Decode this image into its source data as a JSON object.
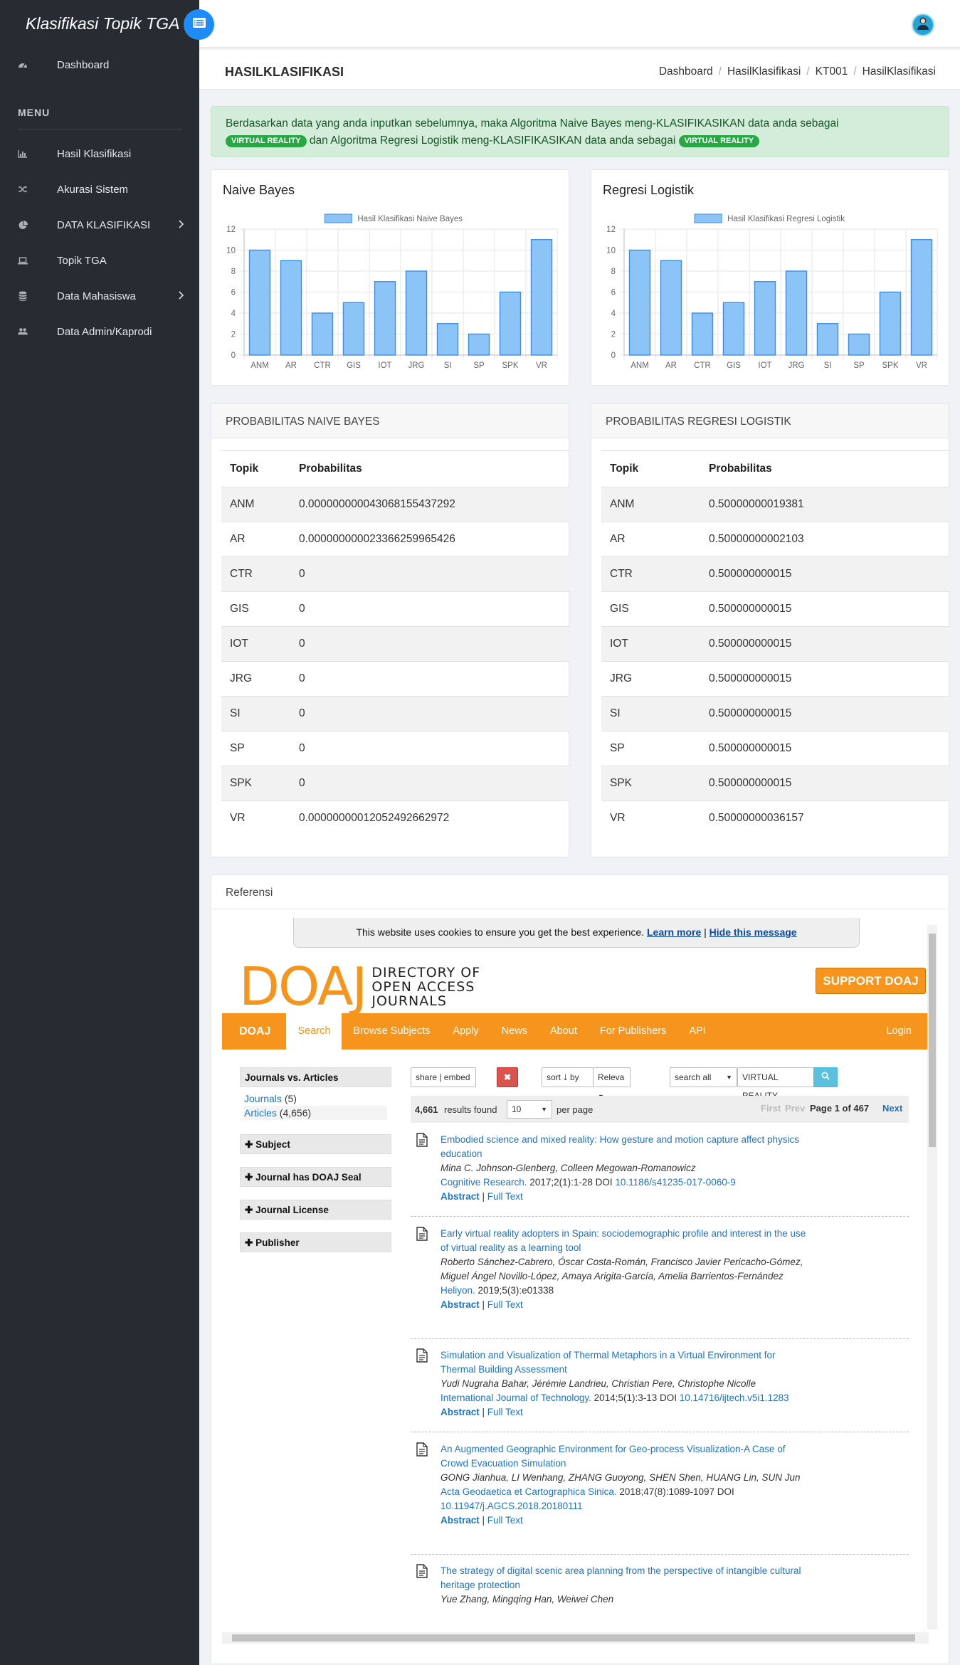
{
  "sidebar": {
    "brand": "Klasifikasi Topik TGA",
    "menu_heading": "MENU",
    "items": [
      {
        "label": "Dashboard",
        "icon": "dashboard-icon"
      },
      {
        "label": "Hasil Klasifikasi",
        "icon": "bar-chart-icon"
      },
      {
        "label": "Akurasi Sistem",
        "icon": "shuffle-icon"
      },
      {
        "label": "DATA KLASIFIKASI",
        "icon": "pie-chart-icon"
      },
      {
        "label": "Topik TGA",
        "icon": "laptop-icon"
      },
      {
        "label": "Data Mahasiswa",
        "icon": "database-icon"
      },
      {
        "label": "Data Admin/Kaprodi",
        "icon": "users-icon"
      }
    ]
  },
  "header": {
    "title": "HASILKLASIFIKASI",
    "breadcrumb": [
      "Dashboard",
      "HasilKlasifikasi",
      "KT001",
      "HasilKlasifikasi"
    ]
  },
  "alert": {
    "text1": "Berdasarkan data yang anda inputkan sebelumnya, maka Algoritma Naive Bayes meng-KLASIFIKASIKAN data anda sebagai",
    "badge1": "VIRTUAL REALITY",
    "text2": "dan Algoritma Regresi Logistik meng-KLASIFIKASIKAN data anda sebagai",
    "badge2": "VIRTUAL REALITY"
  },
  "charts": {
    "nb_title": "Naive Bayes",
    "lr_title": "Regresi Logistik"
  },
  "chart_data": [
    {
      "type": "bar",
      "title": "Naive Bayes",
      "categories": [
        "ANM",
        "AR",
        "CTR",
        "GIS",
        "IOT",
        "JRG",
        "SI",
        "SP",
        "SPK",
        "VR"
      ],
      "series": [
        {
          "name": "Hasil Klasifikasi Naive Bayes",
          "values": [
            10,
            9,
            4,
            5,
            7,
            8,
            3,
            2,
            6,
            11
          ]
        }
      ],
      "yticks": [
        0,
        2,
        4,
        6,
        8,
        10,
        12
      ],
      "ylim": [
        0,
        12
      ],
      "color": "#8cc4f7",
      "border_color": "#3b8de6",
      "legend_position": "top",
      "grid": true
    },
    {
      "type": "bar",
      "title": "Regresi Logistik",
      "categories": [
        "ANM",
        "AR",
        "CTR",
        "GIS",
        "IOT",
        "JRG",
        "SI",
        "SP",
        "SPK",
        "VR"
      ],
      "series": [
        {
          "name": "Hasil Klasifikasi Regresi Logistik",
          "values": [
            10,
            9,
            4,
            5,
            7,
            8,
            3,
            2,
            6,
            11
          ]
        }
      ],
      "yticks": [
        0,
        2,
        4,
        6,
        8,
        10,
        12
      ],
      "ylim": [
        0,
        12
      ],
      "color": "#8cc4f7",
      "border_color": "#3b8de6",
      "legend_position": "top",
      "grid": true
    }
  ],
  "prob_nb": {
    "heading": "PROBABILITAS NAIVE BAYES",
    "col_topik": "Topik",
    "col_prob": "Probabilitas",
    "rows": [
      {
        "topik": "ANM",
        "prob": "0.000000000043068155437292"
      },
      {
        "topik": "AR",
        "prob": "0.000000000023366259965426"
      },
      {
        "topik": "CTR",
        "prob": "0"
      },
      {
        "topik": "GIS",
        "prob": "0"
      },
      {
        "topik": "IOT",
        "prob": "0"
      },
      {
        "topik": "JRG",
        "prob": "0"
      },
      {
        "topik": "SI",
        "prob": "0"
      },
      {
        "topik": "SP",
        "prob": "0"
      },
      {
        "topik": "SPK",
        "prob": "0"
      },
      {
        "topik": "VR",
        "prob": "0.00000000012052492662972"
      }
    ]
  },
  "prob_lr": {
    "heading": "PROBABILITAS REGRESI LOGISTIK",
    "col_topik": "Topik",
    "col_prob": "Probabilitas",
    "rows": [
      {
        "topik": "ANM",
        "prob": "0.50000000019381"
      },
      {
        "topik": "AR",
        "prob": "0.50000000002103"
      },
      {
        "topik": "CTR",
        "prob": "0.500000000015"
      },
      {
        "topik": "GIS",
        "prob": "0.500000000015"
      },
      {
        "topik": "IOT",
        "prob": "0.500000000015"
      },
      {
        "topik": "JRG",
        "prob": "0.500000000015"
      },
      {
        "topik": "SI",
        "prob": "0.500000000015"
      },
      {
        "topik": "SP",
        "prob": "0.500000000015"
      },
      {
        "topik": "SPK",
        "prob": "0.500000000015"
      },
      {
        "topik": "VR",
        "prob": "0.50000000036157"
      }
    ]
  },
  "referensi": {
    "heading": "Referensi",
    "cookie_text": "This website uses cookies to ensure you get the best experience.",
    "cookie_learn": "Learn more",
    "cookie_sep": "|",
    "cookie_hide": "Hide this message",
    "logo_big": "DOAJ",
    "logo_line1": "DIRECTORY OF",
    "logo_line2": "OPEN ACCESS",
    "logo_line3": "JOURNALS",
    "support": "SUPPORT DOAJ",
    "nav": [
      "DOAJ",
      "Search",
      "Browse Subjects",
      "Apply",
      "News",
      "About",
      "For Publishers",
      "API"
    ],
    "login": "Login",
    "facets": {
      "jva": "Journals vs. Articles",
      "journals": "Journals",
      "journals_count": "(5)",
      "articles": "Articles",
      "articles_count": "(4,656)",
      "subject": "Subject",
      "seal": "Journal has DOAJ Seal",
      "license": "Journal License",
      "publisher": "Publisher"
    },
    "controls": {
      "share": "share | embed",
      "sort": "sort",
      "by": "by",
      "relevance": "Releva",
      "search_all": "search all",
      "query": "VIRTUAL REALITY"
    },
    "paging": {
      "count": "4,661",
      "found": "results found",
      "per_page_value": "10",
      "per_page": "per page",
      "first": "First",
      "prev": "Prev",
      "page": "Page 1 of 467",
      "next": "Next"
    },
    "results": [
      {
        "title": "Embodied science and mixed reality: How gesture and motion capture affect physics education",
        "authors": "Mina C. Johnson-Glenberg, Colleen Megowan-Romanowicz",
        "journal": "Cognitive Research.",
        "meta": "2017;2(1):1-28 DOI",
        "doi": "10.1186/s41235-017-0060-9",
        "abstract": "Abstract",
        "fulltext": "Full Text"
      },
      {
        "title": "Early virtual reality adopters in Spain: sociodemographic profile and interest in the use of virtual reality as a learning tool",
        "authors": "Roberto Sánchez-Cabrero, Óscar Costa-Román, Francisco Javier Pericacho-Gómez, Miguel Ángel Novillo-López, Amaya Arigita-García, Amelia Barrientos-Fernández",
        "journal": "Heliyon.",
        "meta": "2019;5(3):e01338",
        "doi": "",
        "abstract": "Abstract",
        "fulltext": "Full Text"
      },
      {
        "title": "Simulation and Visualization of Thermal Metaphors in a Virtual Environment for Thermal Building Assessment",
        "authors": "Yudi Nugraha Bahar, Jérémie Landrieu, Christian Pere, Christophe Nicolle",
        "journal": "International Journal of Technology.",
        "meta": "2014;5(1):3-13 DOI",
        "doi": "10.14716/ijtech.v5i1.1283",
        "abstract": "Abstract",
        "fulltext": "Full Text"
      },
      {
        "title": "An Augmented Geographic Environment for Geo-process Visualization-A Case of Crowd Evacuation Simulation",
        "authors": "GONG Jianhua, LI Wenhang, ZHANG Guoyong, SHEN Shen, HUANG Lin, SUN Jun",
        "journal": "Acta Geodaetica et Cartographica Sinica.",
        "meta": "2018;47(8):1089-1097 DOI",
        "doi": "10.11947/j.AGCS.2018.20180111",
        "abstract": "Abstract",
        "fulltext": "Full Text"
      },
      {
        "title": "The strategy of digital scenic area planning from the perspective of intangible cultural heritage protection",
        "authors": "Yue Zhang, Mingqing Han, Weiwei Chen",
        "journal": "",
        "meta": "",
        "doi": "",
        "abstract": "",
        "fulltext": ""
      }
    ]
  }
}
